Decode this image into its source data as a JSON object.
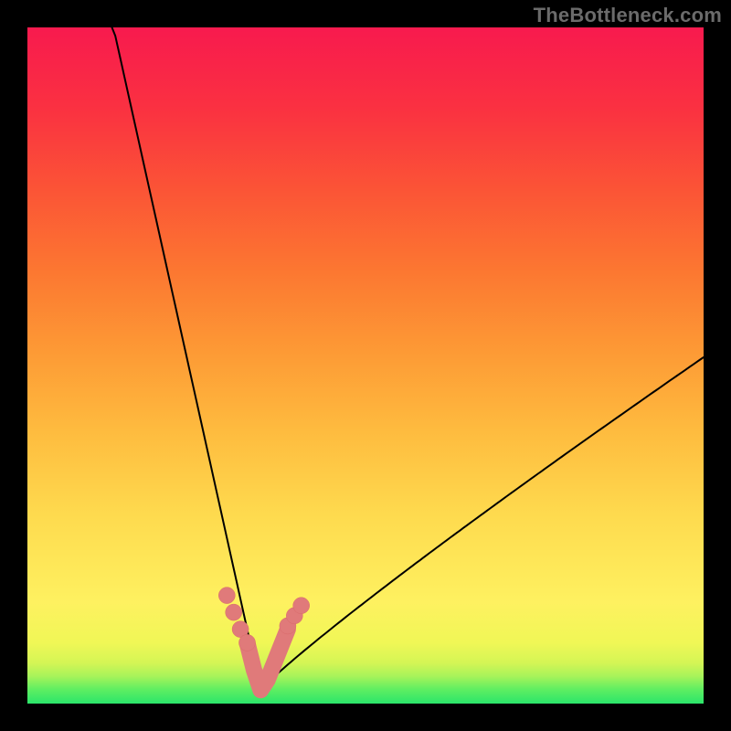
{
  "watermark": "TheBottleneck.com",
  "colors": {
    "highlight": "#e07a7a",
    "curve": "#000000",
    "gradient_top": "#f81a4e",
    "gradient_bottom": "#2be56a"
  },
  "chart_data": {
    "type": "line",
    "title": "",
    "xlabel": "",
    "ylabel": "",
    "xlim": [
      0,
      100
    ],
    "ylim": [
      0,
      100
    ],
    "curve_model": {
      "description": "|x - x0| shaped bottleneck curve asymmetric",
      "x0": 34.5,
      "left_slope": 4.5,
      "right_slope": 1.05,
      "right_power": 0.92,
      "y_floor": 2.0
    },
    "series": [
      {
        "name": "bottleneck-curve",
        "x": [
          0,
          2,
          4,
          6,
          8,
          10,
          12,
          14,
          16,
          18,
          20,
          22,
          24,
          26,
          28,
          30,
          32,
          33,
          34,
          34.5,
          35,
          36,
          37,
          39,
          41,
          44,
          48,
          52,
          56,
          60,
          64,
          68,
          72,
          76,
          80,
          84,
          88,
          92,
          96,
          100
        ],
        "y": [
          100,
          100,
          100,
          100,
          98,
          90,
          81,
          72,
          63,
          55,
          47,
          40,
          33,
          26,
          20,
          14.5,
          10,
          8,
          5,
          2,
          4,
          7,
          9,
          12.5,
          15.5,
          19.5,
          24,
          28,
          32,
          35.5,
          38.5,
          41.5,
          44.5,
          47,
          49.5,
          52,
          54,
          56,
          58,
          60
        ]
      }
    ],
    "highlight_dots": {
      "x": [
        29.5,
        30.5,
        31.5,
        32.5,
        38.5,
        39.5,
        40.5
      ],
      "y": [
        16.0,
        13.5,
        11.0,
        9.0,
        11.5,
        13.0,
        14.5
      ]
    },
    "trough_path": {
      "x": [
        32.5,
        33.5,
        34.5,
        35.5,
        36.5,
        37.5,
        38.5
      ],
      "y": [
        9.0,
        5.0,
        2.0,
        3.5,
        6.0,
        8.5,
        11.0
      ]
    }
  }
}
